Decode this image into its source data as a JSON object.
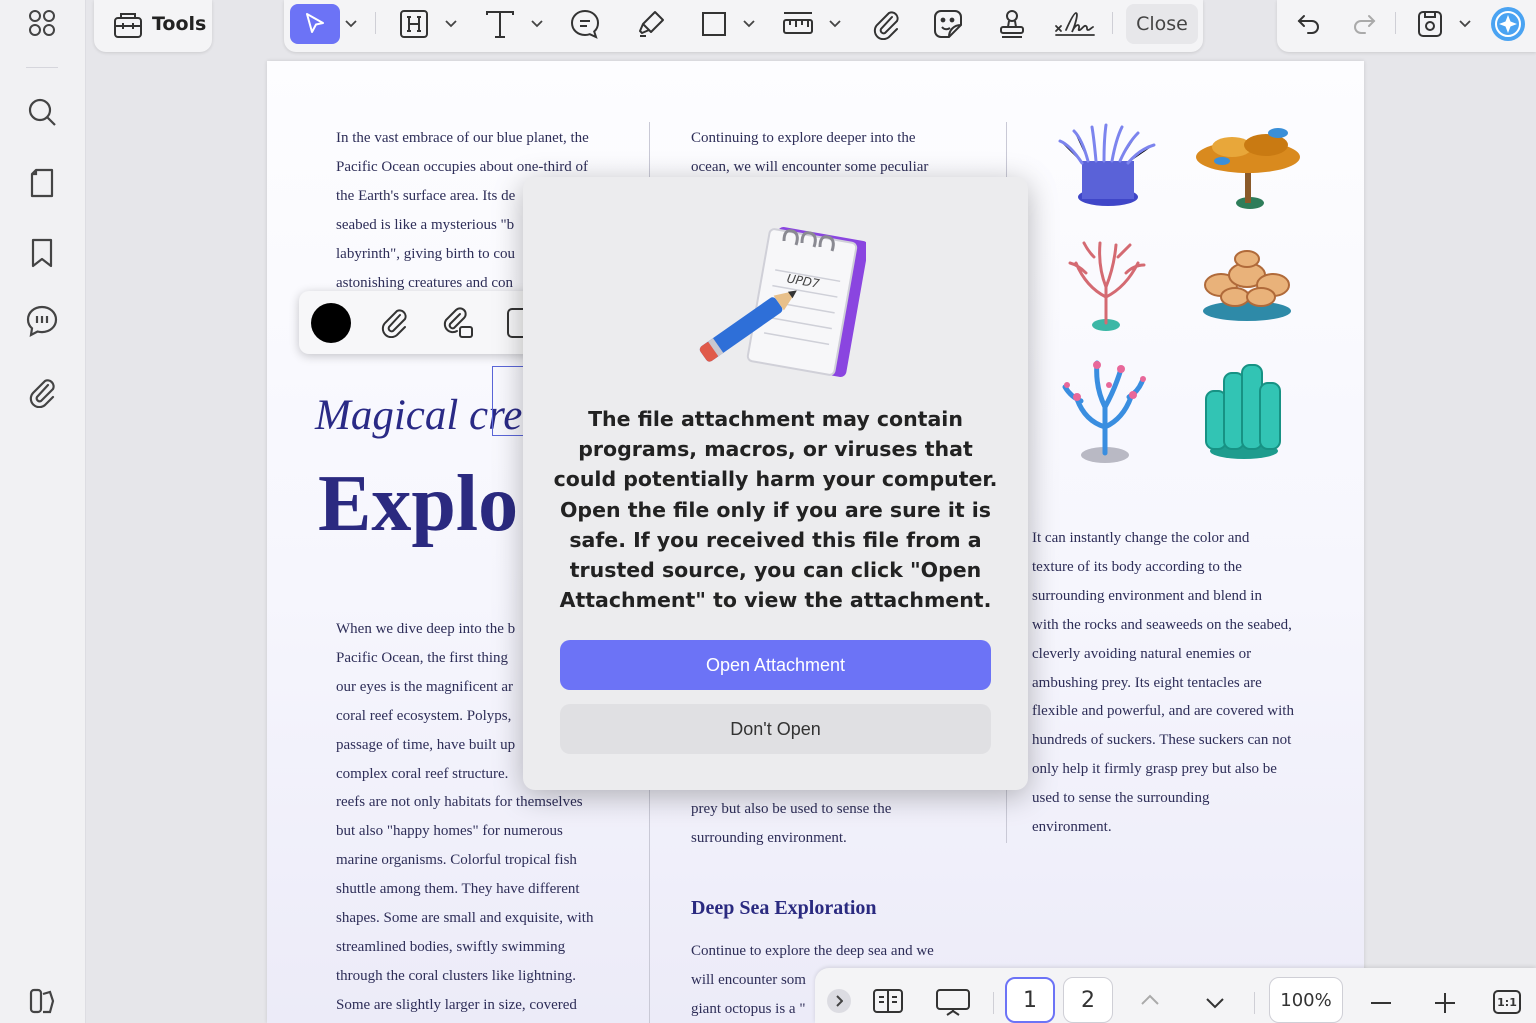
{
  "toolbar": {
    "tools_label": "Tools",
    "close_label": "Close",
    "colors": {
      "accent": "#6c73f6",
      "select_active": "#6c73f6"
    }
  },
  "document": {
    "col1_top": [
      "In the vast embrace of our blue planet, the",
      "Pacific Ocean occupies about one-third of",
      "the Earth's surface area. Its de",
      "seabed is like a mysterious \"b",
      "labyrinth\", giving birth to cou",
      "astonishing creatures and con"
    ],
    "col2_top": [
      "Continuing to explore deeper into the",
      "ocean, we will encounter some peculiar"
    ],
    "heading_italic": "Magical cre",
    "heading_big": "Explo",
    "col1_bottom": [
      "When we dive deep into the b",
      "Pacific Ocean, the first thing",
      "our eyes is the magnificent ar",
      "coral reef ecosystem. Polyps,",
      "passage of time, have built up",
      "complex coral reef structure.",
      "reefs are not only habitats for themselves",
      "but also \"happy homes\" for numerous",
      "marine organisms. Colorful tropical fish",
      "shuttle among them. They have different",
      "shapes. Some are small and exquisite, with",
      "streamlined bodies, swiftly swimming",
      "through the coral clusters like lightning.",
      "Some are slightly larger in size, covered"
    ],
    "col2_mid": [
      "prey but also be used to sense the",
      "surrounding environment."
    ],
    "section_heading": "Deep Sea Exploration",
    "col2_bottom": [
      "Continue to explore the deep sea and we",
      "will encounter som",
      "giant octopus is a \""
    ],
    "col3": [
      "It can instantly change the color and",
      "texture of its body according to the",
      "surrounding environment and blend in",
      "with the rocks and seaweeds on the seabed,",
      "cleverly avoiding natural enemies or",
      "ambushing prey. Its eight tentacles are",
      "flexible and powerful, and are covered with",
      "hundreds of suckers. These suckers can not",
      "only help it firmly grasp prey but also be",
      "used to sense the surrounding",
      "environment."
    ]
  },
  "modal": {
    "note_text": "UPD7",
    "message": "The file attachment may contain programs, macros, or viruses that could potentially harm your computer. Open the file only if you are sure it is safe. If you received this file from a trusted source, you can click \"Open Attachment\" to view the attachment.",
    "open_label": "Open Attachment",
    "dont_open_label": "Don't Open",
    "open_color": "#6c73f6"
  },
  "bottombar": {
    "page_current": "1",
    "page_next": "2",
    "zoom": "100%",
    "fit_label": "1:1"
  },
  "icons": {
    "rail": [
      "apps-grid-icon",
      "search-icon",
      "page-icon",
      "bookmark-icon",
      "comment-icon",
      "attachment-icon",
      "sidebar-toggle-icon"
    ],
    "toolbar": [
      "select-cursor-icon",
      "heading-icon",
      "text-icon",
      "comment-bubble-icon",
      "highlighter-icon",
      "rectangle-icon",
      "ruler-icon",
      "paperclip-icon",
      "sticker-icon",
      "stamp-icon",
      "signature-icon"
    ],
    "right": [
      "undo-icon",
      "redo-icon",
      "save-icon",
      "ai-assistant-icon"
    ]
  }
}
